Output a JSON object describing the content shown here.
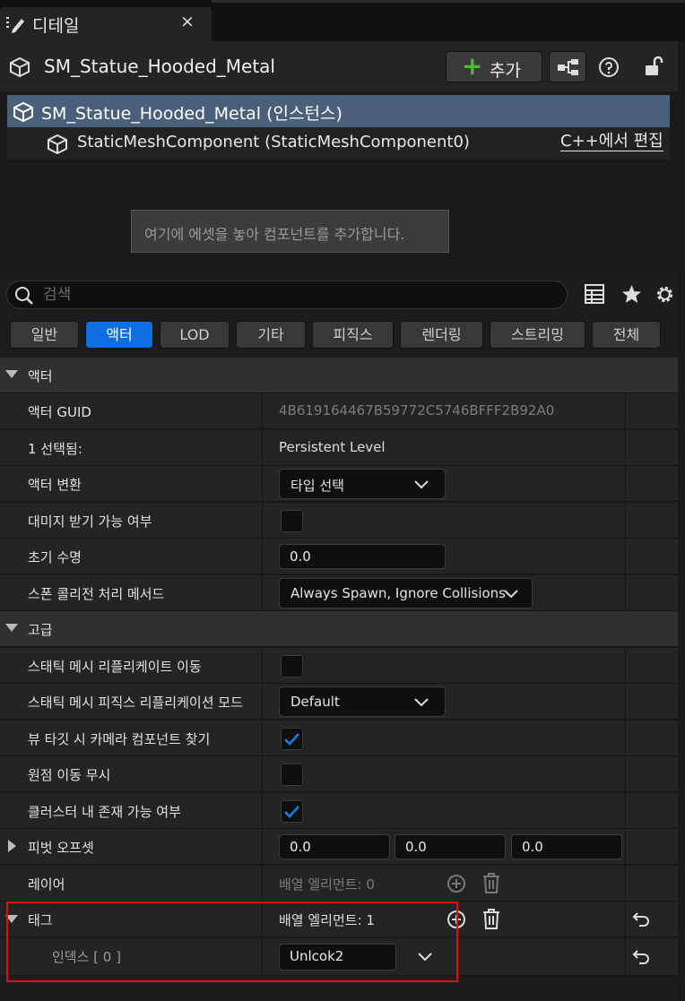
{
  "tab": {
    "title": "디테일",
    "close": "×"
  },
  "header": {
    "title": "SM_Statue_Hooded_Metal",
    "add_label": "추가",
    "add_plus": "+"
  },
  "tree": {
    "root_label": "SM_Statue_Hooded_Metal (인스턴스)",
    "child_label": "StaticMeshComponent (StaticMeshComponent0)",
    "edit_cpp": "C++에서 편집",
    "drop_hint": "여기에 에셋을 놓아 컴포넌트를 추가합니다."
  },
  "search": {
    "placeholder": "검색"
  },
  "filters": [
    "일반",
    "액터",
    "LOD",
    "기타",
    "피직스",
    "렌더링",
    "스트리밍",
    "전체"
  ],
  "filters_active": "액터",
  "sections": {
    "actor": {
      "title": "액터",
      "guid_label": "액터 GUID",
      "guid_value": "4B619164467B59772C5746BFFF2B92A0",
      "selected_label": "1 선택됨:",
      "selected_value": "Persistent Level",
      "transform_label": "액터 변환",
      "transform_value": "타입 선택",
      "damage_label": "대미지 받기 가능 여부",
      "damage_checked": false,
      "lifespan_label": "초기 수명",
      "lifespan_value": "0.0",
      "spawn_label": "스폰 콜리전 처리 메서드",
      "spawn_value": "Always Spawn, Ignore Collisions"
    },
    "advanced": {
      "title": "고급",
      "replicate_label": "스태틱 메시 리플리케이트 이동",
      "replicate_checked": false,
      "physics_rep_label": "스태틱 메시 피직스 리플리케이션 모드",
      "physics_rep_value": "Default",
      "viewtarget_label": "뷰 타깃 시 카메라 컴포넌트 찾기",
      "viewtarget_checked": true,
      "ignore_origin_label": "원점 이동 무시",
      "ignore_origin_checked": false,
      "cluster_label": "클러스터 내 존재 가능 여부",
      "cluster_checked": true,
      "pivot_label": "피벗 오프셋",
      "pivot_x": "0.0",
      "pivot_y": "0.0",
      "pivot_z": "0.0",
      "layer_label": "레이어",
      "layer_value": "배열 엘리먼트: 0",
      "tag_label": "태그",
      "tag_value": "배열 엘리먼트: 1",
      "index_label": "인덱스 [ 0 ]",
      "index_value": "Unlcok2"
    }
  }
}
